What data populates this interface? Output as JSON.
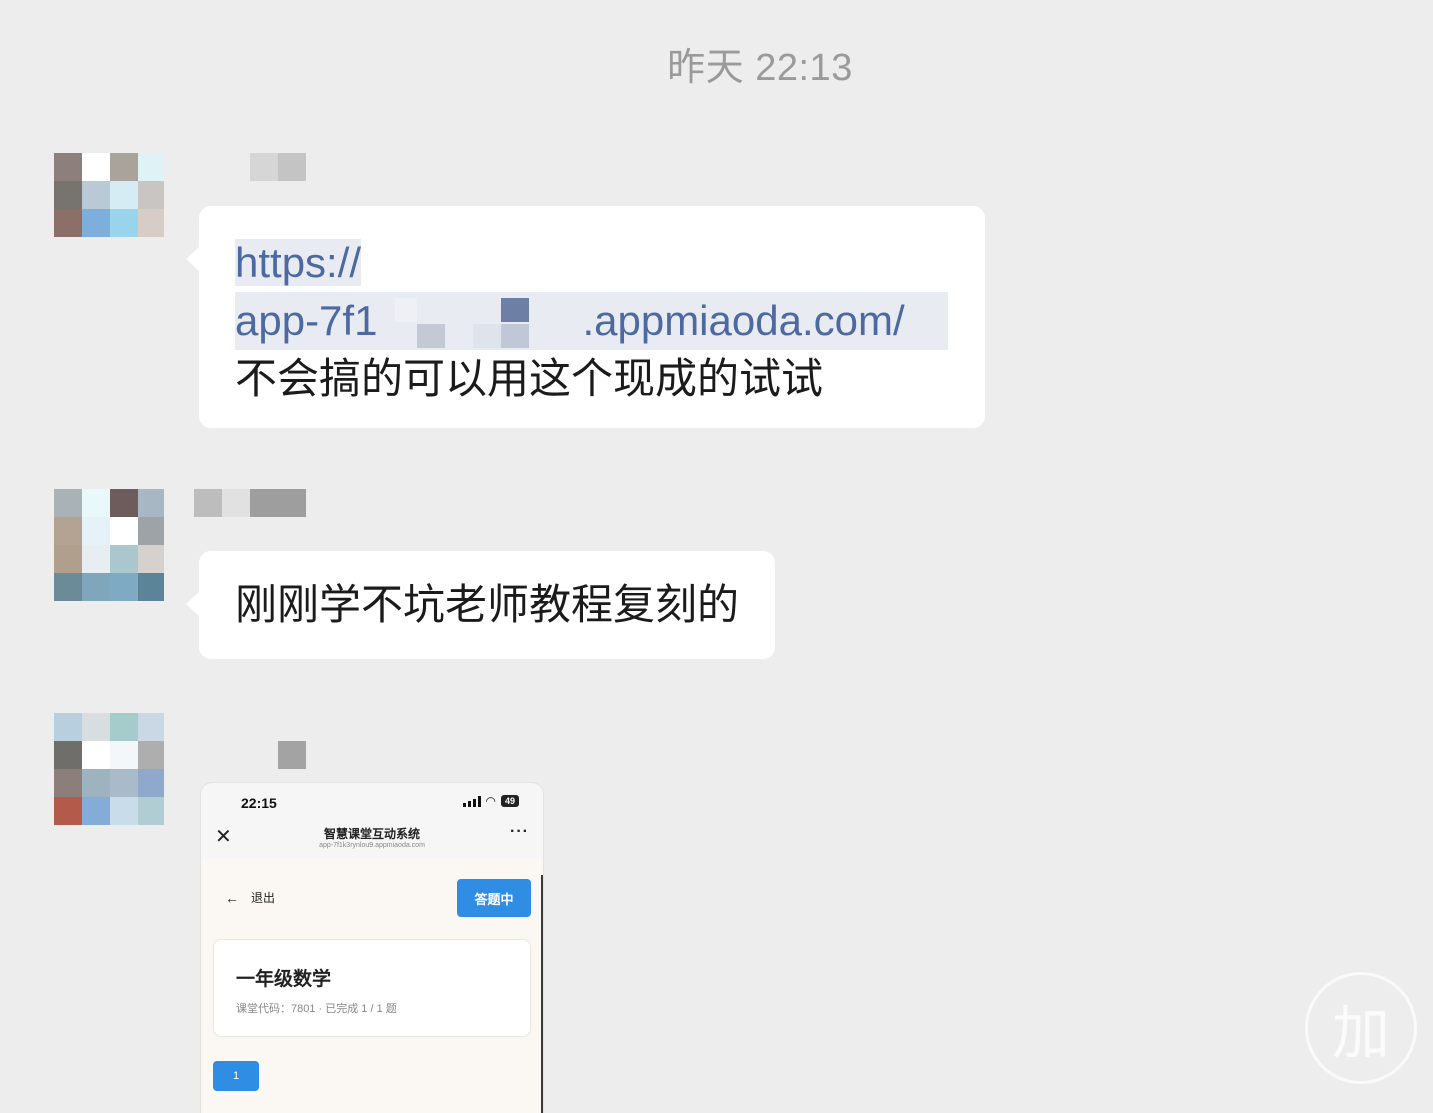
{
  "chat": {
    "timestamp": "昨天 22:13",
    "messages": [
      {
        "link_line_1": "https://",
        "link_prefix": "app-7f1",
        "link_suffix": ".appmiaoda.com/",
        "text": "不会搞的可以用这个现成的试试"
      },
      {
        "text": "刚刚学不坑老师教程复刻的"
      }
    ]
  },
  "screenshot": {
    "time": "22:15",
    "battery": "49",
    "nav_title": "智慧课堂互动系统",
    "nav_url": "app-7f1k3rynlou9.appmiaoda.com",
    "back_label": "退出",
    "status_button": "答题中",
    "course_title": "一年级数学",
    "course_meta": "课堂代码：7801 · 已完成 1 / 1 题",
    "question_number": "1"
  },
  "watermark": {
    "glyph": "加"
  },
  "colors": {
    "background": "#ededed",
    "bubble": "#ffffff",
    "link": "#4c6aa1",
    "accent": "#2f8de4"
  },
  "icons": [
    "close-icon",
    "more-icon",
    "back-arrow-icon",
    "signal-icon",
    "wifi-icon",
    "battery-icon"
  ]
}
